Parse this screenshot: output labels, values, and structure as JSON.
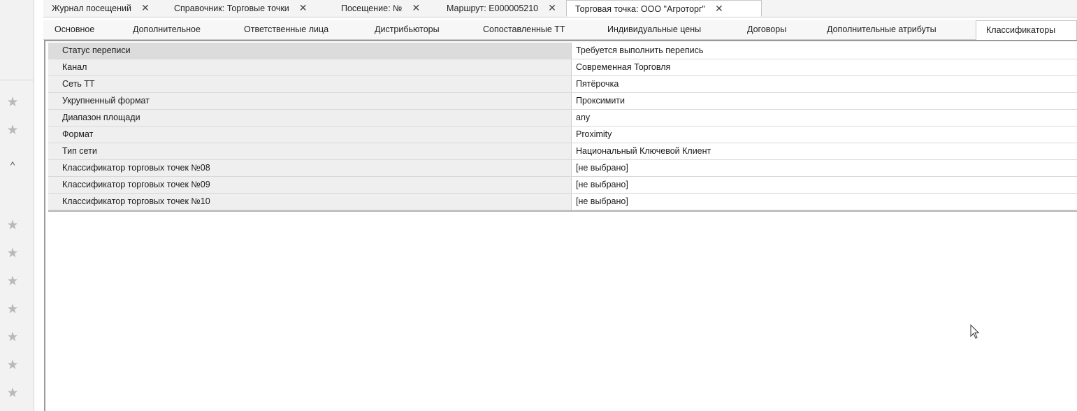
{
  "sidebar": {
    "icons": [
      "star-icon",
      "star-icon",
      "chevron-up-icon",
      "star-icon",
      "star-icon",
      "star-icon",
      "star-icon",
      "star-icon",
      "star-icon",
      "star-icon"
    ]
  },
  "doc_tabs": [
    {
      "label": "Журнал посещений"
    },
    {
      "label": "Справочник: Торговые точки"
    },
    {
      "label": "Посещение: №"
    },
    {
      "label": "Маршрут:  E000005210"
    },
    {
      "label": "Торговая точка:  ООО \"Агроторг\""
    }
  ],
  "form_tabs": [
    {
      "label": "Основное"
    },
    {
      "label": "Дополнительное"
    },
    {
      "label": "Ответственные лица"
    },
    {
      "label": "Дистрибьюторы"
    },
    {
      "label": "Сопоставленные ТТ"
    },
    {
      "label": "Индивидуальные цены"
    },
    {
      "label": "Договоры"
    },
    {
      "label": "Дополнительные атрибуты"
    },
    {
      "label": "Классификаторы"
    }
  ],
  "properties": [
    {
      "name": "Статус переписи",
      "value": "Требуется выполнить перепись"
    },
    {
      "name": "Канал",
      "value": "Современная Торговля"
    },
    {
      "name": "Сеть ТТ",
      "value": "Пятёрочка"
    },
    {
      "name": "Укрупненный формат",
      "value": "Проксимити"
    },
    {
      "name": "Диапазон площади",
      "value": "any"
    },
    {
      "name": "Формат",
      "value": "Proximity"
    },
    {
      "name": "Тип сети",
      "value": "Национальный Ключевой Клиент"
    },
    {
      "name": "Классификатор торговых точек №08",
      "value": "[не выбрано]"
    },
    {
      "name": "Классификатор торговых точек №09",
      "value": "[не выбрано]"
    },
    {
      "name": "Классификатор торговых точек №10",
      "value": "[не выбрано]"
    }
  ],
  "close_glyph": "✕",
  "star_glyph": "★",
  "chevron_glyph": "^"
}
